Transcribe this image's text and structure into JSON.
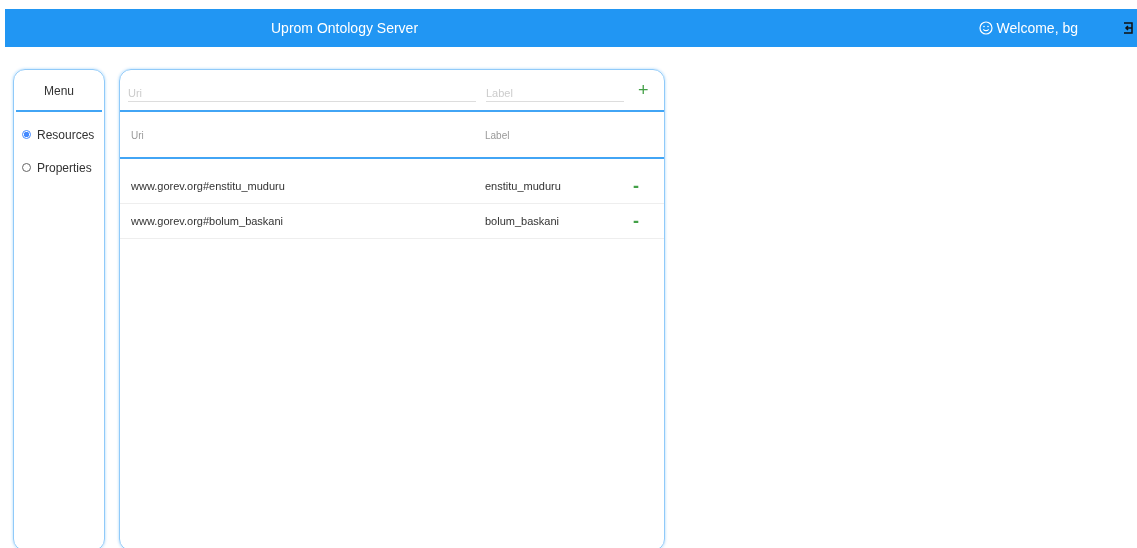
{
  "header": {
    "title": "Uprom Ontology Server",
    "welcome": "Welcome, bg"
  },
  "menu": {
    "title": "Menu",
    "items": [
      {
        "label": "Resources",
        "selected": true
      },
      {
        "label": "Properties",
        "selected": false
      }
    ]
  },
  "form": {
    "uri_placeholder": "Uri",
    "label_placeholder": "Label",
    "add": "+"
  },
  "table": {
    "columns": [
      "Uri",
      "Label"
    ],
    "rows": [
      {
        "uri": "www.gorev.org#enstitu_muduru",
        "label": "enstitu_muduru",
        "remove": "-"
      },
      {
        "uri": "www.gorev.org#bolum_baskani",
        "label": "bolum_baskani",
        "remove": "-"
      }
    ]
  }
}
